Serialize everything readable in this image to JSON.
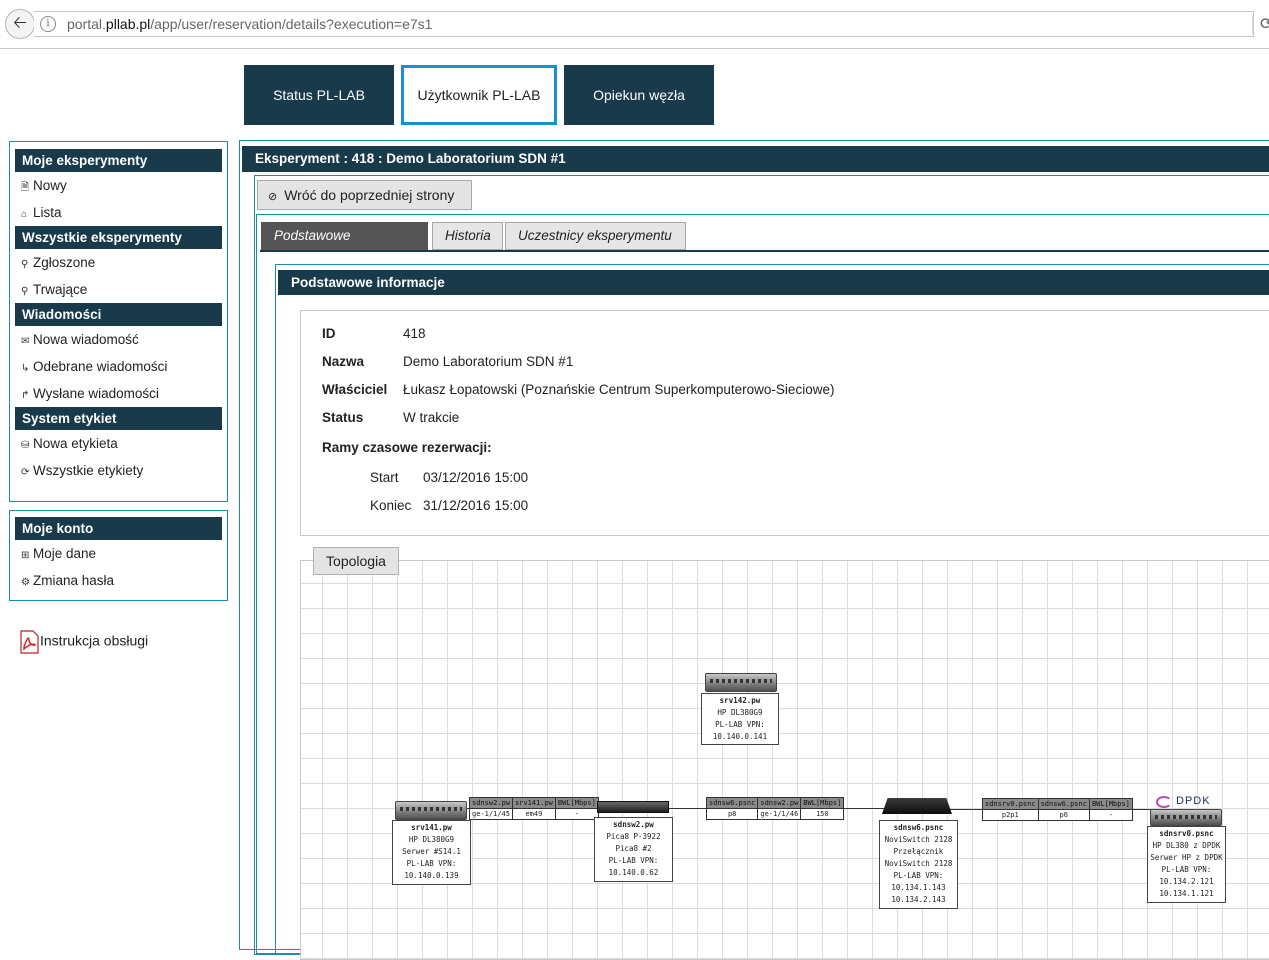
{
  "browser": {
    "url_prefix": "portal.",
    "url_domain": "pllab.pl",
    "url_suffix": "/app/user/reservation/details?execution=e7s1"
  },
  "top_tabs": [
    {
      "label": "Status PL-LAB"
    },
    {
      "label": "Użytkownik PL-LAB"
    },
    {
      "label": "Opiekun węzła"
    }
  ],
  "sidebar": {
    "groups": [
      {
        "title": "Moje eksperymenty",
        "items": [
          {
            "label": "Nowy",
            "icon": "file-icon"
          },
          {
            "label": "Lista",
            "icon": "home-icon"
          }
        ]
      },
      {
        "title": "Wszystkie eksperymenty",
        "items": [
          {
            "label": "Zgłoszone",
            "icon": "search-icon"
          },
          {
            "label": "Trwające",
            "icon": "search-icon"
          }
        ]
      },
      {
        "title": "Wiadomości",
        "items": [
          {
            "label": "Nowa wiadomość",
            "icon": "envelope-icon"
          },
          {
            "label": "Odebrane wiadomości",
            "icon": "arrow-return-icon"
          },
          {
            "label": "Wysłane wiadomości",
            "icon": "arrow-up-icon"
          }
        ]
      },
      {
        "title": "System etykiet",
        "items": [
          {
            "label": "Nowa etykieta",
            "icon": "tag-icon"
          },
          {
            "label": "Wszystkie etykiety",
            "icon": "refresh-icon"
          }
        ]
      }
    ],
    "account": {
      "title": "Moje konto",
      "items": [
        {
          "label": "Moje dane",
          "icon": "card-icon"
        },
        {
          "label": "Zmiana hasła",
          "icon": "key-icon"
        }
      ]
    },
    "manual_link": "Instrukcja obsługi"
  },
  "main": {
    "header": "Eksperyment : 418 : Demo Laboratorium SDN #1",
    "back_button": "Wróć do poprzedniej strony",
    "tabs": [
      {
        "label": "Podstawowe informacje"
      },
      {
        "label": "Historia"
      },
      {
        "label": "Uczestnicy eksperymentu"
      }
    ],
    "section_title": "Podstawowe informacje",
    "info": {
      "id_label": "ID",
      "id_value": "418",
      "name_label": "Nazwa",
      "name_value": "Demo Laboratorium SDN #1",
      "owner_label": "Właściciel",
      "owner_value": "Łukasz Łopatowski (Poznańskie Centrum Superkomputerowo-Sieciowe)",
      "status_label": "Status",
      "status_value": "W trakcie",
      "timeframe_label": "Ramy czasowe rezerwacji:",
      "start_label": "Start",
      "start_value": "03/12/2016 15:00",
      "end_label": "Koniec",
      "end_value": "31/12/2016 15:00"
    },
    "topology_button": "Topologia"
  },
  "topology": {
    "nodes": {
      "srv142": {
        "name": "srv142.pw",
        "lines": [
          "HP DL380G9",
          "PL-LAB VPN:",
          "10.140.0.141"
        ]
      },
      "srv141": {
        "name": "srv141.pw",
        "lines": [
          "HP DL380G9",
          "Serwer #S14.1",
          "PL-LAB VPN:",
          "10.140.0.139"
        ]
      },
      "sdnsw2": {
        "name": "sdnsw2.pw",
        "lines": [
          "Pica8 P-3922",
          "Pica8 #2",
          "PL-LAB VPN:",
          "10.140.0.62"
        ]
      },
      "sdnsw6": {
        "name": "sdnsw6.psnc",
        "lines": [
          "NoviSwitch 2128",
          "Przełącznik",
          "NoviSwitch 2128",
          "PL-LAB VPN:",
          "10.134.1.143",
          "10.134.2.143"
        ]
      },
      "sdnsrv0": {
        "name": "sdnsrv0.psnc",
        "lines": [
          "HP DL380 z DPDK",
          "Serwer HP z DPDK",
          "PL-LAB VPN:",
          "10.134.2.121",
          "10.134.1.121"
        ]
      }
    },
    "links": [
      {
        "headers": [
          "sdnsw2.pw",
          "srv141.pw",
          "BWL[Mbps]"
        ],
        "values": [
          "ge-1/1/45",
          "em49",
          "-"
        ]
      },
      {
        "headers": [
          "sdnsw6.psnc",
          "sdnsw2.pw",
          "BWL[Mbps]"
        ],
        "values": [
          "p8",
          "ge-1/1/46",
          "150"
        ]
      },
      {
        "headers": [
          "sdnsrv0.psnc",
          "sdnsw6.psnc",
          "BWL[Mbps]"
        ],
        "values": [
          "p2p1",
          "p6",
          "-"
        ]
      }
    ],
    "dpdk_logo": "DPDK"
  }
}
